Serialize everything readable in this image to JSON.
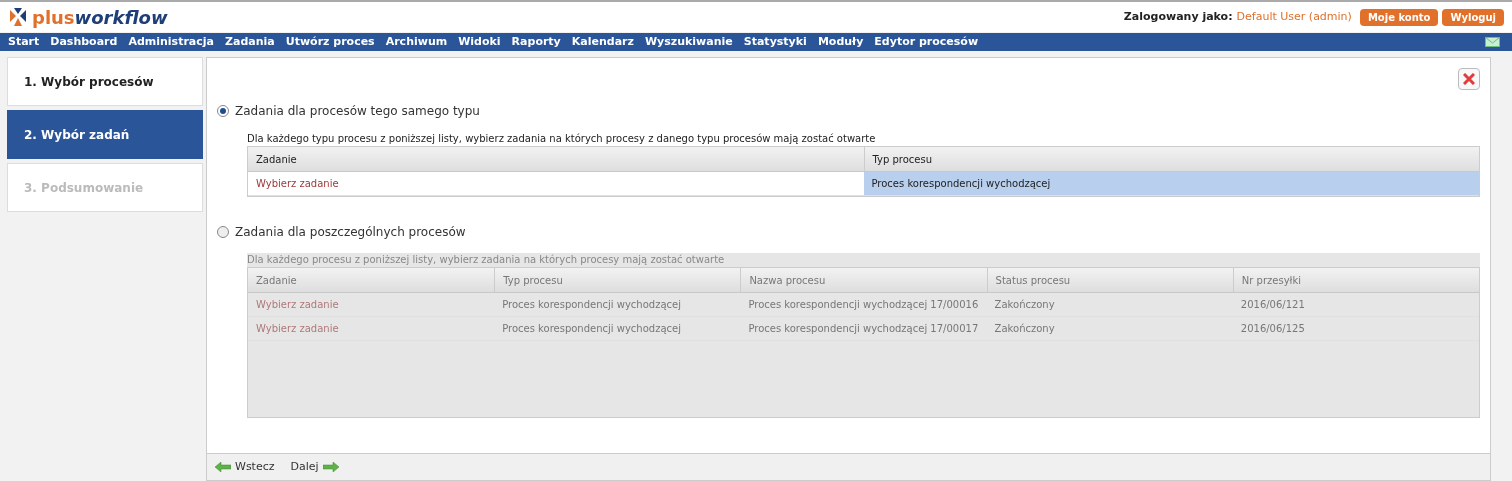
{
  "logo": {
    "part_1": "plus",
    "part_2": "workflow"
  },
  "user": {
    "label": "Zalogowany jako:",
    "name": "Default User (admin)"
  },
  "header_buttons": [
    "Moje konto",
    "Wyloguj"
  ],
  "nav": [
    "Start",
    "Dashboard",
    "Administracja",
    "Zadania",
    "Utwórz proces",
    "Archiwum",
    "Widoki",
    "Raporty",
    "Kalendarz",
    "Wyszukiwanie",
    "Statystyki",
    "Moduły",
    "Edytor procesów"
  ],
  "steps": [
    {
      "label": "1. Wybór procesów",
      "selected": false,
      "disabled": false
    },
    {
      "label": "2. Wybór zadań",
      "selected": true,
      "disabled": false
    },
    {
      "label": "3. Podsumowanie",
      "selected": false,
      "disabled": true
    }
  ],
  "options": [
    {
      "label": "Zadania dla procesów tego samego typu",
      "selected": true,
      "disabled": false,
      "hint": "Dla każdego typu procesu z poniższej listy, wybierz zadania na których procesy z danego typu procesów mają zostać otwarte",
      "columns": [
        "Zadanie",
        "Typ procesu"
      ],
      "rows": [
        {
          "selected": true,
          "cells": [
            "Wybierz zadanie",
            "Proces korespondencji wychodzącej"
          ]
        }
      ]
    },
    {
      "label": "Zadania dla poszczególnych procesów",
      "selected": false,
      "disabled": true,
      "hint": "Dla każdego procesu z poniższej listy, wybierz zadania na których procesy mają zostać otwarte",
      "columns": [
        "Zadanie",
        "Typ procesu",
        "Nazwa procesu",
        "Status procesu",
        "Nr przesyłki"
      ],
      "rows": [
        {
          "selected": false,
          "cells": [
            "Wybierz zadanie",
            "Proces korespondencji wychodzącej",
            "Proces korespondencji wychodzącej 17/00016",
            "Zakończony",
            "2016/06/121"
          ]
        },
        {
          "selected": false,
          "cells": [
            "Wybierz zadanie",
            "Proces korespondencji wychodzącej",
            "Proces korespondencji wychodzącej 17/00017",
            "Zakończony",
            "2016/06/125"
          ]
        }
      ]
    }
  ],
  "footer": {
    "back": "Wstecz",
    "next": "Dalej"
  }
}
